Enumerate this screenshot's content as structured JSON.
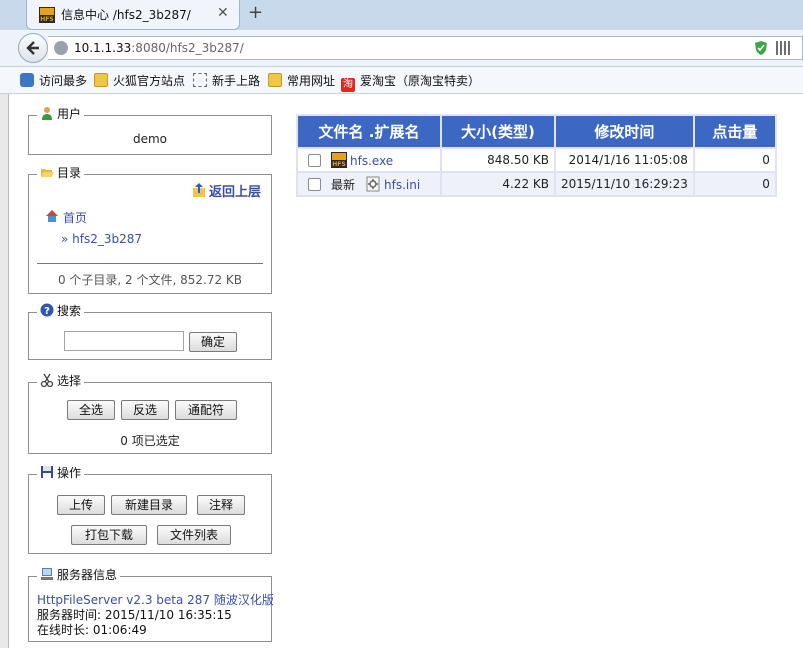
{
  "browser": {
    "tab_title": "信息中心 /hfs2_3b287/",
    "url_host": "10.1.1.33",
    "url_rest": ":8080/hfs2_3b287/",
    "bookmarks": [
      {
        "label": "访问最多",
        "icon": "search-icon"
      },
      {
        "label": "火狐官方站点",
        "icon": "folder-icon"
      },
      {
        "label": "新手上路",
        "icon": "dashed-page-icon"
      },
      {
        "label": "常用网址",
        "icon": "folder-icon"
      },
      {
        "label": "爱淘宝（原淘宝特卖）",
        "icon": "taobao-icon"
      }
    ],
    "taobao_glyph": "淘"
  },
  "user": {
    "legend": "用户",
    "name": "demo"
  },
  "directory": {
    "legend": "目录",
    "up_label": "返回上层",
    "home_label": "首页",
    "current": "» hfs2_3b287",
    "summary": "0 个子目录, 2 个文件, 852.72 KB"
  },
  "search": {
    "legend": "搜索",
    "value": "",
    "submit": "确定"
  },
  "select": {
    "legend": "选择",
    "all": "全选",
    "invert": "反选",
    "wildcard": "通配符",
    "status": "0 项已选定"
  },
  "actions": {
    "legend": "操作",
    "upload": "上传",
    "new_folder": "新建目录",
    "comment": "注释",
    "archive": "打包下载",
    "file_list": "文件列表"
  },
  "server": {
    "legend": "服务器信息",
    "version": "HttpFileServer v2.3 beta 287 随波汉化版",
    "time": "服务器时间: 2015/11/10 16:35:15",
    "uptime": "在线时长: 01:06:49"
  },
  "table": {
    "headers": [
      "文件名 .扩展名",
      "大小(类型)",
      "修改时间",
      "点击量"
    ],
    "rows": [
      {
        "prefix": "",
        "name": "hfs.exe",
        "icon": "hfs-exe-icon",
        "size": "848.50 KB",
        "modified": "2014/1/16 11:05:08",
        "hits": "0"
      },
      {
        "prefix": "最新",
        "name": "hfs.ini",
        "icon": "ini-file-icon",
        "size": "4.22 KB",
        "modified": "2015/11/10 16:29:23",
        "hits": "0"
      }
    ]
  }
}
